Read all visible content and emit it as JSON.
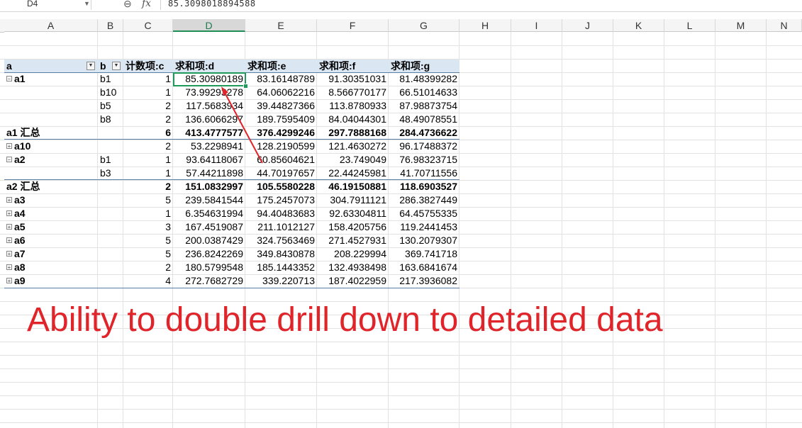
{
  "formula_bar": {
    "cell_ref": "D4",
    "dropdown_icon": "caret-down-icon",
    "zoom_icon": "magnifier-icon",
    "fx_label": "fx",
    "value": "85.3098018894588"
  },
  "columns": [
    "A",
    "B",
    "C",
    "D",
    "E",
    "F",
    "G",
    "H",
    "I",
    "J",
    "K",
    "L",
    "M",
    "N"
  ],
  "selected_column": "D",
  "pivot": {
    "headers": [
      "a",
      "b",
      "计数项:c",
      "求和项:d",
      "求和项:e",
      "求和项:f",
      "求和项:g"
    ],
    "rows": [
      {
        "a": "a1",
        "b": "b1",
        "c": "1",
        "d": "85.30980189",
        "e": "83.16148789",
        "f": "91.30351031",
        "g": "81.48399282",
        "expander": "⊟",
        "bold": false
      },
      {
        "a": "",
        "b": "b10",
        "c": "1",
        "d": "73.99293278",
        "e": "64.06062216",
        "f": "8.566770177",
        "g": "66.51014633",
        "expander": "",
        "bold": false
      },
      {
        "a": "",
        "b": "b5",
        "c": "2",
        "d": "117.5683934",
        "e": "39.44827366",
        "f": "113.8780933",
        "g": "87.98873754",
        "expander": "",
        "bold": false
      },
      {
        "a": "",
        "b": "b8",
        "c": "2",
        "d": "136.6066297",
        "e": "189.7595409",
        "f": "84.04044301",
        "g": "48.49078551",
        "expander": "",
        "bold": false
      },
      {
        "a": "a1 汇总",
        "b": "",
        "c": "6",
        "d": "413.4777577",
        "e": "376.4299246",
        "f": "297.7888168",
        "g": "284.4736622",
        "expander": "",
        "bold": true
      },
      {
        "a": "a10",
        "b": "",
        "c": "2",
        "d": "53.2298941",
        "e": "128.2190599",
        "f": "121.4630272",
        "g": "96.17488372",
        "expander": "⊞",
        "bold": false
      },
      {
        "a": "a2",
        "b": "b1",
        "c": "1",
        "d": "93.64118067",
        "e": "60.85604621",
        "f": "23.749049",
        "g": "76.98323715",
        "expander": "⊟",
        "bold": false
      },
      {
        "a": "",
        "b": "b3",
        "c": "1",
        "d": "57.44211898",
        "e": "44.70197657",
        "f": "22.44245981",
        "g": "41.70711556",
        "expander": "",
        "bold": false
      },
      {
        "a": "a2 汇总",
        "b": "",
        "c": "2",
        "d": "151.0832997",
        "e": "105.5580228",
        "f": "46.19150881",
        "g": "118.6903527",
        "expander": "",
        "bold": true
      },
      {
        "a": "a3",
        "b": "",
        "c": "5",
        "d": "239.5841544",
        "e": "175.2457073",
        "f": "304.7911121",
        "g": "286.3827449",
        "expander": "⊞",
        "bold": false
      },
      {
        "a": "a4",
        "b": "",
        "c": "1",
        "d": "6.354631994",
        "e": "94.40483683",
        "f": "92.63304811",
        "g": "64.45755335",
        "expander": "⊞",
        "bold": false
      },
      {
        "a": "a5",
        "b": "",
        "c": "3",
        "d": "167.4519087",
        "e": "211.1012127",
        "f": "158.4205756",
        "g": "119.2441453",
        "expander": "⊞",
        "bold": false
      },
      {
        "a": "a6",
        "b": "",
        "c": "5",
        "d": "200.0387429",
        "e": "324.7563469",
        "f": "271.4527931",
        "g": "130.2079307",
        "expander": "⊞",
        "bold": false
      },
      {
        "a": "a7",
        "b": "",
        "c": "5",
        "d": "236.8242269",
        "e": "349.8430878",
        "f": "208.229994",
        "g": "369.741718",
        "expander": "⊞",
        "bold": false
      },
      {
        "a": "a8",
        "b": "",
        "c": "2",
        "d": "180.5799548",
        "e": "185.1443352",
        "f": "132.4938498",
        "g": "163.6841674",
        "expander": "⊞",
        "bold": false
      },
      {
        "a": "a9",
        "b": "",
        "c": "4",
        "d": "272.7682729",
        "e": "339.220713",
        "f": "187.4022959",
        "g": "217.3936082",
        "expander": "⊞",
        "bold": false
      }
    ]
  },
  "caption": "Ability to double drill down to detailed data",
  "colors": {
    "caption": "#e0242a",
    "arrow": "#e0242a",
    "selection": "#1f9a5a",
    "header_fill": "#dbe6f3"
  }
}
